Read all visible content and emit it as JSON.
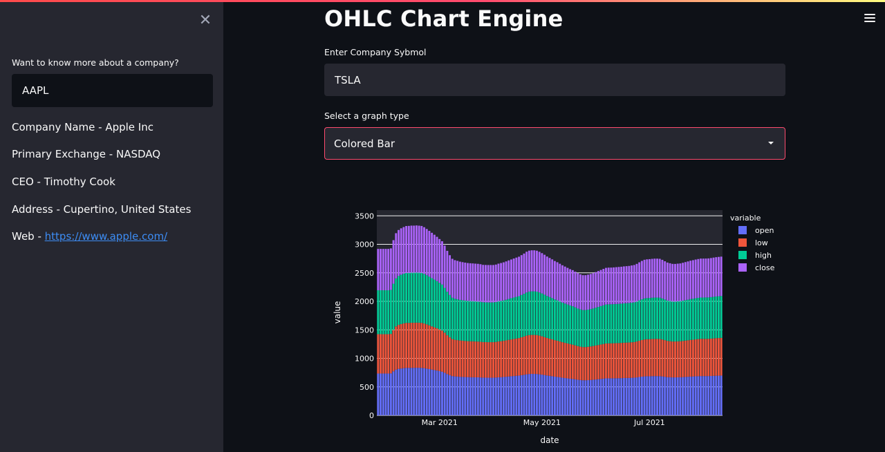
{
  "sidebar": {
    "close_icon": "close-icon",
    "prompt_label": "Want to know more about a company?",
    "symbol_value": "AAPL",
    "info": [
      {
        "label": "Company Name - Apple Inc"
      },
      {
        "label": "Primary Exchange - NASDAQ"
      },
      {
        "label": "CEO - Timothy Cook"
      },
      {
        "label": "Address - Cupertino, United States"
      }
    ],
    "web_label": "Web - ",
    "web_link": "https://www.apple.com/"
  },
  "main": {
    "title": "OHLC Chart Engine",
    "menu_icon": "hamburger-menu-icon",
    "symbol_label": "Enter Company Sybmol",
    "symbol_value": "TSLA",
    "graph_label": "Select a graph type",
    "graph_value": "Colored Bar"
  },
  "colors": {
    "accent": "#ff4b6e",
    "open": "#636efa",
    "low": "#ef553b",
    "high": "#00cc96",
    "close": "#ab63fa",
    "plot_bg": "#262730"
  },
  "chart_data": {
    "type": "bar",
    "stacked": true,
    "xlabel": "date",
    "ylabel": "value",
    "legend_title": "variable",
    "legend_position": "right",
    "grid": true,
    "ylim": [
      0,
      3600
    ],
    "yticks": [
      0,
      500,
      1000,
      1500,
      2000,
      2500,
      3000,
      3500
    ],
    "xticks": [
      {
        "index": 24,
        "label": "Mar 2021"
      },
      {
        "index": 64,
        "label": "May 2021"
      },
      {
        "index": 106,
        "label": "Jul 2021"
      }
    ],
    "series": [
      {
        "name": "open",
        "values": [
          734,
          734,
          734,
          734,
          734,
          736,
          772,
          802,
          816,
          822,
          828,
          833,
          833,
          834,
          834,
          835,
          835,
          833,
          828,
          820,
          812,
          803,
          795,
          786,
          776,
          766,
          747,
          724,
          705,
          689,
          683,
          680,
          676,
          674,
          672,
          671,
          669,
          668,
          667,
          667,
          665,
          662,
          661,
          661,
          661,
          661,
          663,
          667,
          670,
          673,
          677,
          682,
          686,
          690,
          694,
          698,
          705,
          712,
          720,
          725,
          727,
          727,
          725,
          720,
          714,
          707,
          699,
          693,
          687,
          679,
          674,
          667,
          660,
          654,
          649,
          643,
          639,
          632,
          625,
          620,
          616,
          616,
          618,
          621,
          625,
          629,
          634,
          639,
          644,
          649,
          649,
          650,
          650,
          651,
          652,
          653,
          655,
          656,
          657,
          659,
          661,
          666,
          673,
          679,
          684,
          686,
          686,
          688,
          689,
          688,
          688,
          683,
          677,
          670,
          668,
          666,
          666,
          667,
          668,
          671,
          674,
          677,
          680,
          682,
          685,
          687,
          689,
          689,
          689,
          689,
          691,
          693,
          695,
          696,
          698
        ]
      },
      {
        "name": "low",
        "values": [
          690,
          690,
          690,
          690,
          690,
          692,
          727,
          758,
          771,
          779,
          785,
          789,
          789,
          790,
          790,
          791,
          790,
          789,
          783,
          775,
          767,
          758,
          750,
          741,
          731,
          722,
          703,
          681,
          663,
          649,
          643,
          640,
          637,
          635,
          633,
          631,
          631,
          631,
          629,
          628,
          626,
          624,
          624,
          623,
          623,
          623,
          625,
          629,
          631,
          634,
          638,
          643,
          646,
          650,
          654,
          658,
          664,
          671,
          679,
          683,
          684,
          684,
          683,
          679,
          673,
          666,
          659,
          652,
          646,
          640,
          635,
          629,
          623,
          618,
          612,
          607,
          602,
          596,
          590,
          585,
          582,
          582,
          585,
          588,
          591,
          596,
          600,
          604,
          608,
          612,
          614,
          614,
          615,
          616,
          617,
          618,
          619,
          620,
          621,
          623,
          625,
          630,
          636,
          642,
          647,
          649,
          650,
          651,
          652,
          653,
          652,
          648,
          642,
          637,
          633,
          630,
          630,
          631,
          632,
          634,
          637,
          640,
          643,
          645,
          648,
          651,
          653,
          653,
          653,
          654,
          655,
          657,
          659,
          660,
          661
        ]
      },
      {
        "name": "high",
        "values": [
          770,
          770,
          770,
          770,
          770,
          773,
          810,
          842,
          857,
          865,
          871,
          876,
          877,
          878,
          878,
          878,
          877,
          876,
          870,
          862,
          853,
          845,
          836,
          827,
          817,
          806,
          786,
          763,
          743,
          725,
          719,
          716,
          712,
          710,
          708,
          706,
          705,
          704,
          703,
          702,
          701,
          698,
          697,
          697,
          697,
          697,
          699,
          703,
          706,
          709,
          713,
          717,
          722,
          727,
          731,
          735,
          742,
          749,
          757,
          763,
          764,
          764,
          762,
          757,
          751,
          744,
          736,
          730,
          723,
          715,
          709,
          702,
          695,
          689,
          683,
          677,
          673,
          666,
          658,
          653,
          649,
          649,
          651,
          654,
          658,
          663,
          668,
          673,
          678,
          683,
          684,
          684,
          685,
          686,
          687,
          688,
          690,
          691,
          692,
          694,
          696,
          701,
          708,
          715,
          720,
          722,
          723,
          724,
          725,
          725,
          724,
          719,
          713,
          707,
          704,
          701,
          700,
          702,
          703,
          706,
          709,
          712,
          716,
          718,
          721,
          723,
          725,
          725,
          726,
          726,
          728,
          730,
          731,
          733,
          734
        ]
      },
      {
        "name": "close",
        "values": [
          726,
          726,
          726,
          726,
          726,
          728,
          764,
          793,
          807,
          815,
          819,
          823,
          824,
          826,
          826,
          827,
          825,
          824,
          819,
          812,
          804,
          796,
          787,
          778,
          769,
          760,
          741,
          718,
          698,
          683,
          677,
          674,
          671,
          668,
          666,
          664,
          663,
          662,
          662,
          661,
          659,
          656,
          656,
          656,
          656,
          656,
          658,
          662,
          665,
          668,
          672,
          676,
          680,
          684,
          688,
          692,
          699,
          706,
          714,
          718,
          720,
          720,
          718,
          713,
          707,
          700,
          692,
          686,
          680,
          673,
          668,
          661,
          654,
          649,
          643,
          637,
          633,
          626,
          620,
          615,
          612,
          612,
          614,
          617,
          621,
          625,
          630,
          634,
          639,
          643,
          644,
          644,
          645,
          646,
          647,
          648,
          649,
          650,
          651,
          653,
          655,
          660,
          667,
          673,
          678,
          680,
          681,
          682,
          683,
          683,
          682,
          678,
          671,
          666,
          663,
          660,
          660,
          661,
          662,
          665,
          668,
          671,
          674,
          677,
          679,
          681,
          683,
          683,
          683,
          684,
          685,
          687,
          689,
          690,
          691
        ]
      }
    ]
  }
}
